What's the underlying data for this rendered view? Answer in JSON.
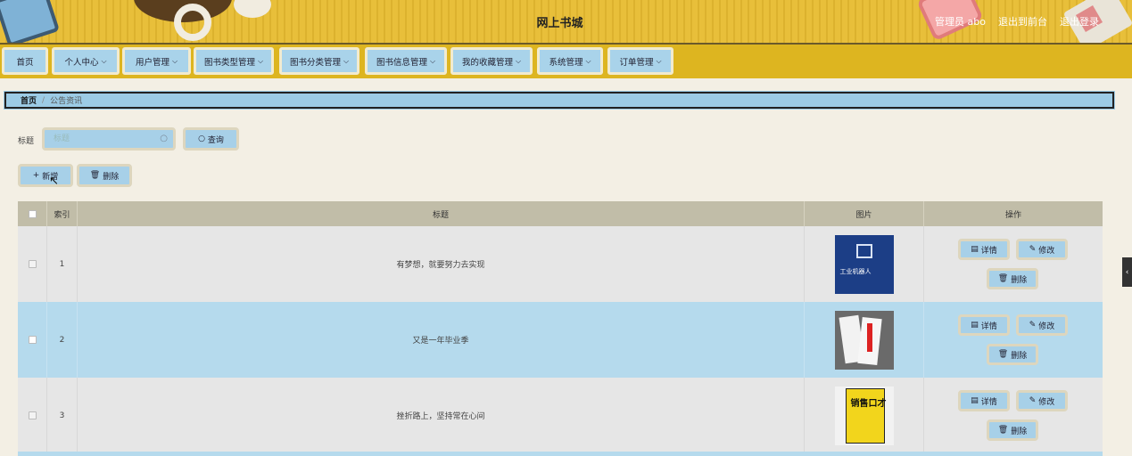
{
  "header": {
    "site_title": "网上书城",
    "admin_label": "管理员 abo",
    "to_front_label": "退出到前台",
    "logout_label": "退出登录"
  },
  "nav": {
    "items": [
      {
        "label": "首页",
        "dropdown": false
      },
      {
        "label": "个人中心",
        "dropdown": true
      },
      {
        "label": "用户管理",
        "dropdown": true
      },
      {
        "label": "图书类型管理",
        "dropdown": true
      },
      {
        "label": "图书分类管理",
        "dropdown": true
      },
      {
        "label": "图书信息管理",
        "dropdown": true
      },
      {
        "label": "我的收藏管理",
        "dropdown": true
      },
      {
        "label": "系统管理",
        "dropdown": true
      },
      {
        "label": "订单管理",
        "dropdown": true
      }
    ],
    "chevron": "⌵"
  },
  "breadcrumb": {
    "home": "首页",
    "separator": "/",
    "current": "公告资讯"
  },
  "search": {
    "label": "标题",
    "placeholder": "标题",
    "query_button": "查询"
  },
  "actions": {
    "add_button": "新增",
    "delete_button": "删除"
  },
  "table": {
    "columns": [
      "索引",
      "标题",
      "图片",
      "操作"
    ],
    "rows": [
      {
        "index": "1",
        "title": "有梦想，就要努力去实现",
        "image_text": "工业机器人",
        "image_icon": "book-robot-icon"
      },
      {
        "index": "2",
        "title": "又是一年毕业季",
        "image_text": "",
        "image_icon": "book-exclamation-icon"
      },
      {
        "index": "3",
        "title": "挫折路上，坚持常在心间",
        "image_text": "销售口才",
        "image_icon": "book-sales-icon"
      }
    ],
    "row_actions": {
      "detail": "详情",
      "edit": "修改",
      "delete": "删除"
    }
  },
  "colors": {
    "header_gold": "#e8bf3a",
    "nav_gold": "#ddb520",
    "button_blue": "#a7d0e8",
    "row_alt_blue": "#b5daed"
  }
}
